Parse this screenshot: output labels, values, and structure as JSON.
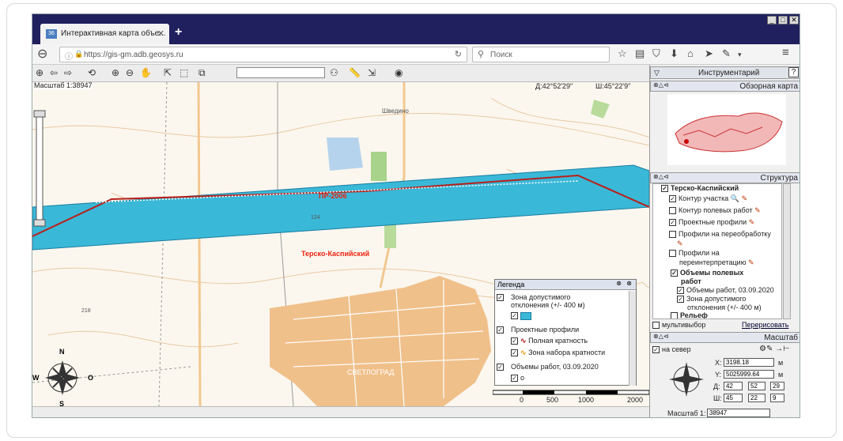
{
  "browser": {
    "tab_title": "Интерактивная карта объе...",
    "favicon_text": "36",
    "url": "https://gis-gm.adb.geosys.ru",
    "search_placeholder": "Поиск"
  },
  "toolbar": {
    "scale_label": "Масштаб 1:38947",
    "lat": "Д:42°52'29\"",
    "lon": "Ш:45°22'9\""
  },
  "map": {
    "labels": {
      "profile": "ПР-2006",
      "region": "Терско-Каспийский",
      "town": "СВЕТЛОГРАД",
      "village": "Шведино",
      "height_124": "124",
      "height_218": "218"
    },
    "scale_ticks": [
      "0",
      "500",
      "1000",
      "2000"
    ],
    "compass": {
      "n": "N",
      "s": "S",
      "w": "W",
      "e": "O"
    }
  },
  "legend": {
    "title": "Легенда",
    "items": [
      {
        "label": "Зона допустимого отклонения (+/- 400 м)",
        "checked": true
      },
      {
        "label": "Проектные профили",
        "checked": true
      },
      {
        "label": "Полная кратность",
        "checked": true
      },
      {
        "label": "Зона набора кратности",
        "checked": true
      },
      {
        "label": "Объемы работ, 03.09.2020",
        "checked": true
      },
      {
        "label": "о",
        "checked": true
      }
    ]
  },
  "panel": {
    "title": "Инструментарий",
    "help": "?",
    "overview_title": "Обзорная карта",
    "structure_title": "Структура",
    "tree": [
      {
        "label": "Терско-Каспийский",
        "checked": true,
        "bold": true
      },
      {
        "label": "Контур участка",
        "checked": true
      },
      {
        "label": "Контур полевых работ",
        "checked": false
      },
      {
        "label": "Проектные профили",
        "checked": true
      },
      {
        "label": "Профили на переобработку",
        "checked": false
      },
      {
        "label": "Профили на",
        "checked": false
      },
      {
        "label": "переинтерпретацию",
        "checked": false
      },
      {
        "label": "Объемы полевых",
        "checked": true,
        "bold": true
      },
      {
        "label": "работ",
        "checked": true,
        "bold": true
      },
      {
        "label": "Объемы работ, 03.09.2020",
        "checked": true
      },
      {
        "label": "Зона допустимого",
        "checked": true
      },
      {
        "label": "отклонения (+/- 400 м)",
        "checked": true
      },
      {
        "label": "Рельеф",
        "checked": false,
        "bold": true
      }
    ],
    "multiselect_label": "мультивыбор",
    "redraw_label": "Перерисовать",
    "scale_title": "Масштаб",
    "north_label": "на север",
    "x_label": "X:",
    "x_value": "3198.18",
    "y_label": "Y:",
    "y_value": "5025999.64",
    "unit_m": "м",
    "d_label": "Д:",
    "d_deg": "42",
    "d_min": "52",
    "d_sec": "29",
    "sh_label": "Ш:",
    "sh_deg": "45",
    "sh_min": "22",
    "sh_sec": "9",
    "scale_label": "Масштаб 1:",
    "scale_value": "38947"
  },
  "colors": {
    "titlebar": "#20205f",
    "corridor": "#3ab8d8",
    "profile_line": "#b8201a",
    "town": "#f0c08a"
  }
}
